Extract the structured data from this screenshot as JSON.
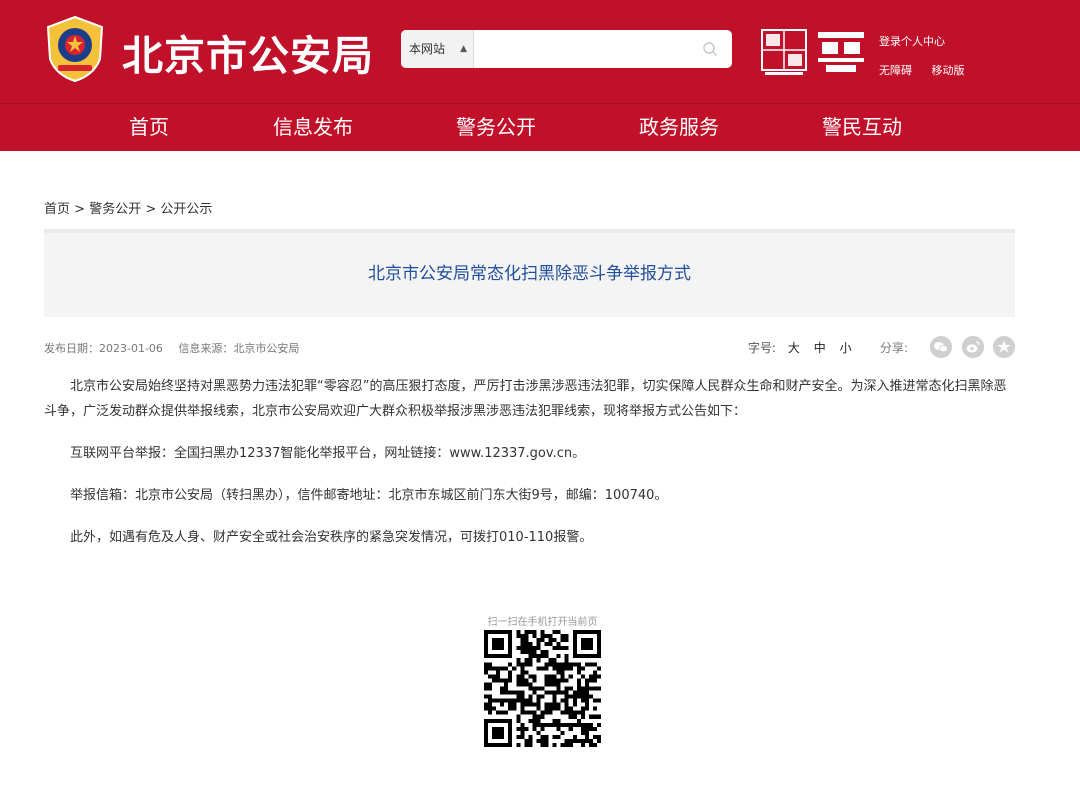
{
  "header": {
    "site_name": "北京市公安局",
    "search_scope": "本网站",
    "search_placeholder": "",
    "links": {
      "login": "登录个人中心",
      "accessible": "无障碍",
      "mobile": "移动版"
    }
  },
  "nav": {
    "items": [
      {
        "label": "首页"
      },
      {
        "label": "信息发布"
      },
      {
        "label": "警务公开"
      },
      {
        "label": "政务服务"
      },
      {
        "label": "警民互动"
      }
    ]
  },
  "breadcrumb": {
    "home": "首页",
    "sep": ">",
    "level1": "警务公开",
    "level2": "公开公示"
  },
  "article": {
    "title": "北京市公安局常态化扫黑除恶斗争举报方式",
    "publish_date": "发布日期：2023-01-06",
    "source": "信息来源：北京市公安局",
    "font_size_label": "字号:",
    "font_sizes": [
      "大",
      "中",
      "小"
    ],
    "share_label": "分享:",
    "paragraphs": [
      "北京市公安局始终坚持对黑恶势力违法犯罪“零容忍”的高压狠打态度，严厉打击涉黑涉恶违法犯罪，切实保障人民群众生命和财产安全。为深入推进常态化扫黑除恶斗争，广泛发动群众提供举报线索，北京市公安局欢迎广大群众积极举报涉黑涉恶违法犯罪线索，现将举报方式公告如下：",
      "互联网平台举报：全国扫黑办12337智能化举报平台，网址链接：www.12337.gov.cn。",
      "举报信箱：北京市公安局（转扫黑办），信件邮寄地址：北京市东城区前门东大街9号，邮编：100740。",
      "此外，如遇有危及人身、财产安全或社会治安秩序的紧急突发情况，可拨打010-110报警。"
    ]
  },
  "qr": {
    "caption": "扫一扫在手机打开当前页"
  },
  "colors": {
    "brand_red": "#c0102a",
    "title_blue": "#1f4e9a"
  },
  "icons": {
    "share": [
      "wechat-icon",
      "weibo-icon",
      "qzone-icon"
    ]
  }
}
